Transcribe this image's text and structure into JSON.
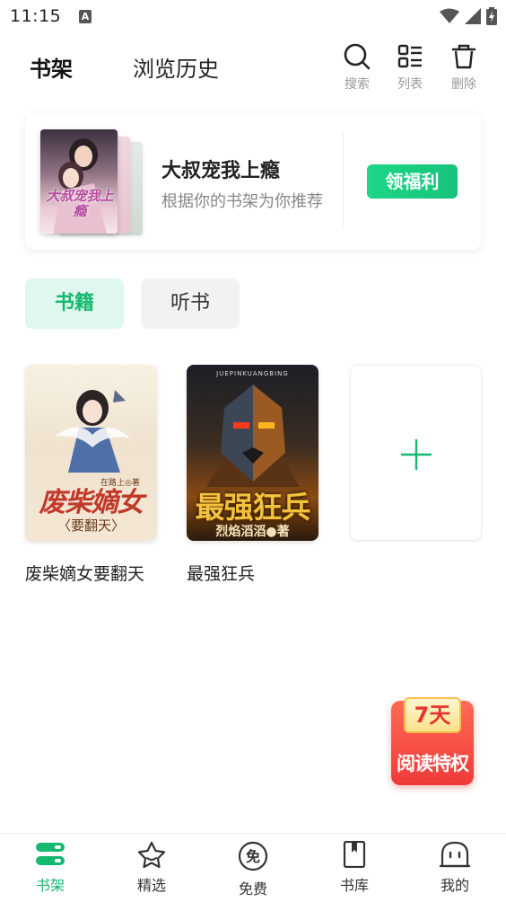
{
  "status_bar": {
    "time": "11:15",
    "notification_letter": "A",
    "icons": [
      "wifi-icon",
      "signal-icon",
      "battery-charging-icon"
    ]
  },
  "header": {
    "tabs": [
      {
        "label": "书架",
        "active": true
      },
      {
        "label": "浏览历史",
        "active": false
      }
    ],
    "actions": [
      {
        "label": "搜索",
        "icon": "search-icon"
      },
      {
        "label": "列表",
        "icon": "list-icon"
      },
      {
        "label": "删除",
        "icon": "trash-icon"
      }
    ]
  },
  "recommend": {
    "cover_text": "大叔宠我上瘾",
    "title": "大叔宠我上瘾",
    "subtitle": "根据你的书架为你推荐",
    "button_label": "领福利"
  },
  "categories": [
    {
      "label": "书籍",
      "active": true
    },
    {
      "label": "听书",
      "active": false
    }
  ],
  "books": [
    {
      "title": "废柴嫡女要翻天",
      "cover_title": "废柴嫡女",
      "cover_subtitle": "〈要翻天〉",
      "cover_author": "在路上◎著"
    },
    {
      "title": "最强狂兵",
      "cover_title": "最强狂兵",
      "cover_top": "JUEPINKUANGBING",
      "cover_author": "烈焰滔滔●著"
    }
  ],
  "add_book": {
    "icon": "plus-icon"
  },
  "promo": {
    "badge": "7天",
    "text": "阅读特权"
  },
  "bottom_nav": [
    {
      "label": "书架",
      "icon": "bookshelf-icon",
      "active": true
    },
    {
      "label": "精选",
      "icon": "star-icon",
      "active": false
    },
    {
      "label": "免费",
      "icon": "free-icon",
      "active": false
    },
    {
      "label": "书库",
      "icon": "book-icon",
      "active": false
    },
    {
      "label": "我的",
      "icon": "profile-icon",
      "active": false
    }
  ],
  "colors": {
    "accent": "#14b86f",
    "accent_light": "#dff7ec",
    "button_gradient": "#1dd687",
    "promo_red": "#f03a3a"
  }
}
